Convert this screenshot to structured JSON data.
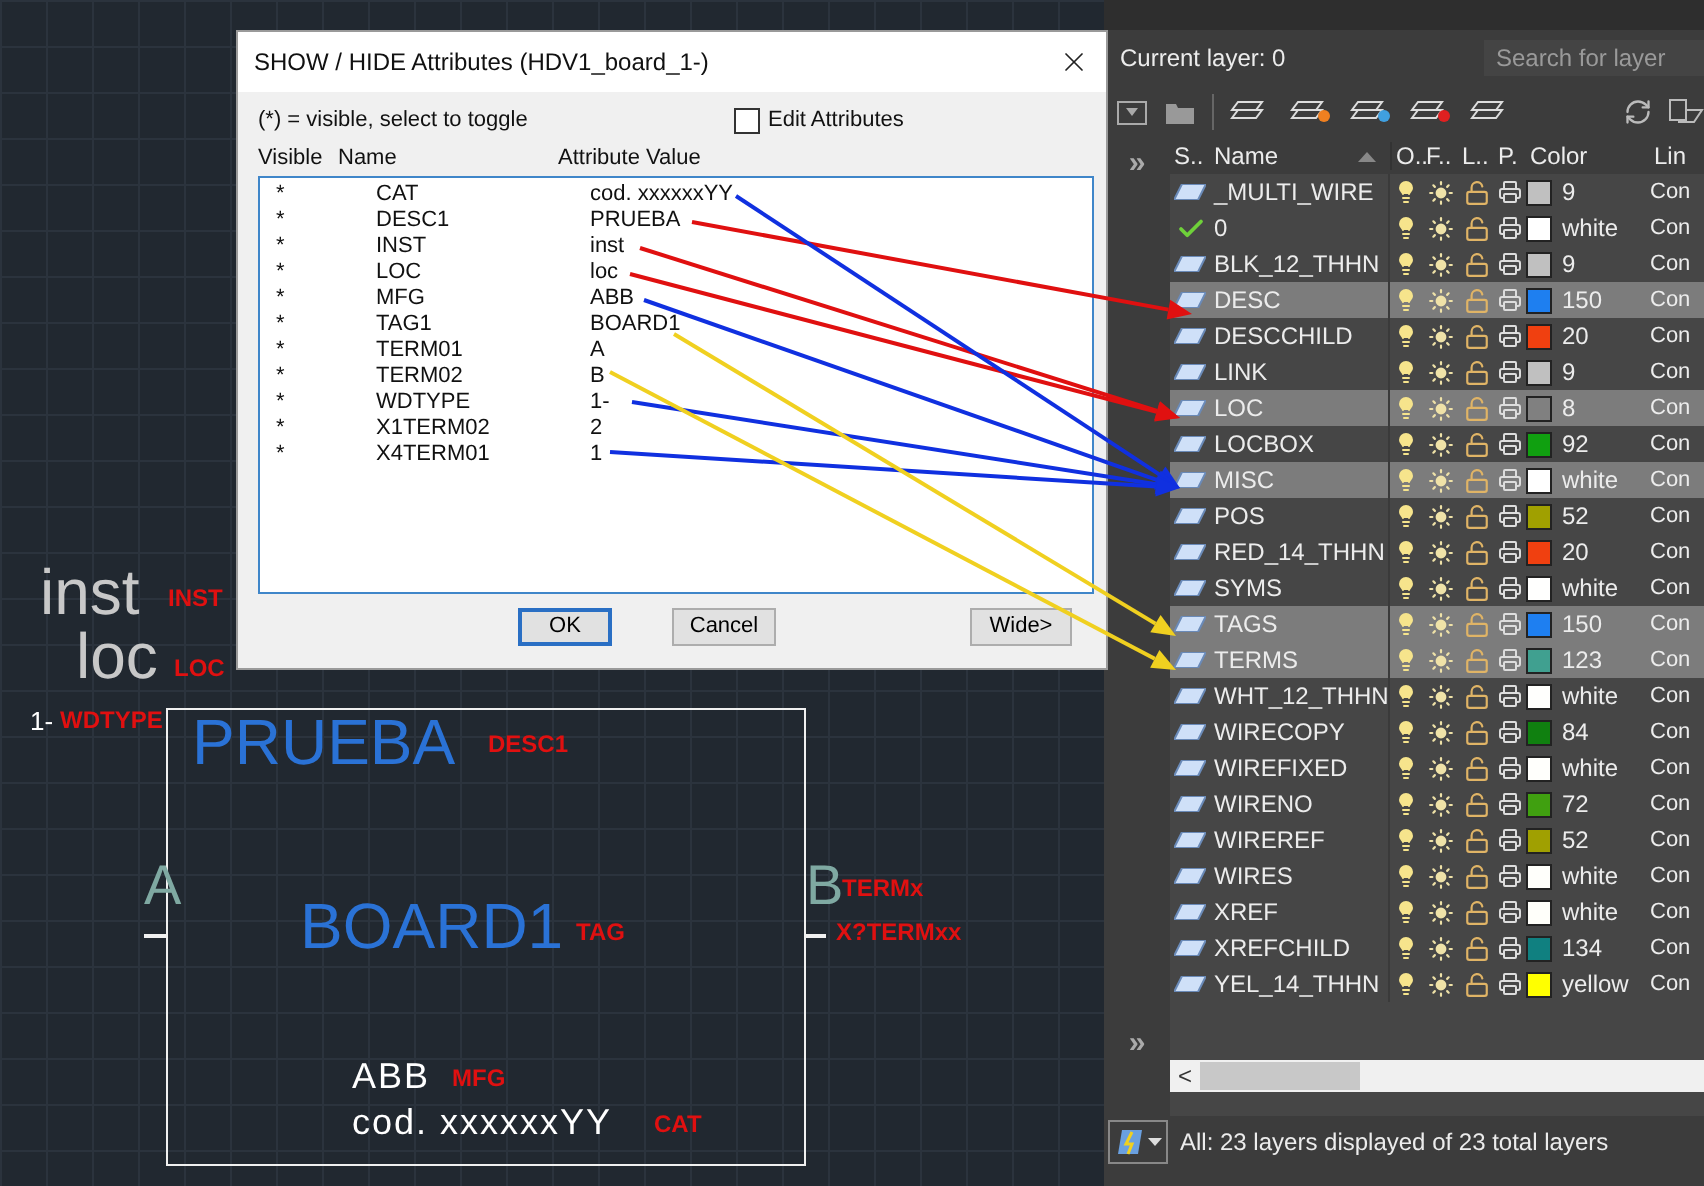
{
  "drawing": {
    "texts": [
      {
        "text": "inst",
        "kind": "value",
        "color": "#c8c8c8"
      },
      {
        "text": "INST",
        "kind": "tag",
        "color": "#e01010"
      },
      {
        "text": "loc",
        "kind": "value",
        "color": "#c8c8c8"
      },
      {
        "text": "LOC",
        "kind": "tag",
        "color": "#e01010"
      },
      {
        "text": "1-",
        "kind": "small",
        "color": "#ffffff"
      },
      {
        "text": "WDTYPE",
        "kind": "tag",
        "color": "#e01010"
      },
      {
        "text": "PRUEBA",
        "kind": "value",
        "color": "#2a72d6"
      },
      {
        "text": "DESC1",
        "kind": "tag",
        "color": "#e01010"
      },
      {
        "text": "A",
        "kind": "pin",
        "color": "#7fa9a2"
      },
      {
        "text": "B",
        "kind": "pin",
        "color": "#7fa9a2"
      },
      {
        "text": "TERMx",
        "kind": "tag",
        "color": "#e01010"
      },
      {
        "text": "X?TERMxx",
        "kind": "tag",
        "color": "#e01010"
      },
      {
        "text": "BOARD1",
        "kind": "value",
        "color": "#2a72d6"
      },
      {
        "text": "TAG",
        "kind": "tag",
        "color": "#e01010"
      },
      {
        "text": "ABB",
        "kind": "mid",
        "color": "#ffffff"
      },
      {
        "text": "MFG",
        "kind": "tag",
        "color": "#e01010"
      },
      {
        "text": "cod. xxxxxxYY",
        "kind": "mid",
        "color": "#ffffff"
      },
      {
        "text": "CAT",
        "kind": "tag",
        "color": "#e01010"
      }
    ]
  },
  "dialog": {
    "title": "SHOW / HIDE Attributes (HDV1_board_1-)",
    "hint": "(*) = visible, select to toggle",
    "edit_attributes": {
      "label": "Edit Attributes",
      "checked": false
    },
    "columns": [
      "Visible",
      "Name",
      "Attribute Value"
    ],
    "attributes": [
      {
        "visible": "*",
        "name": "CAT",
        "value": "cod. xxxxxxYY"
      },
      {
        "visible": "*",
        "name": "DESC1",
        "value": "PRUEBA"
      },
      {
        "visible": "*",
        "name": "INST",
        "value": "inst"
      },
      {
        "visible": "*",
        "name": "LOC",
        "value": "loc"
      },
      {
        "visible": "*",
        "name": "MFG",
        "value": "ABB"
      },
      {
        "visible": "*",
        "name": "TAG1",
        "value": "BOARD1"
      },
      {
        "visible": "*",
        "name": "TERM01",
        "value": "A"
      },
      {
        "visible": "*",
        "name": "TERM02",
        "value": "B"
      },
      {
        "visible": "*",
        "name": "WDTYPE",
        "value": "1-"
      },
      {
        "visible": "*",
        "name": "X1TERM02",
        "value": "2"
      },
      {
        "visible": "*",
        "name": "X4TERM01",
        "value": "1"
      }
    ],
    "buttons": [
      {
        "label": "OK",
        "kind": "default"
      },
      {
        "label": "Cancel",
        "kind": "normal"
      },
      {
        "label": "Wide>",
        "kind": "normal"
      }
    ]
  },
  "annotation_arrows": [
    {
      "color": "#e01010"
    },
    {
      "color": "#e01010"
    },
    {
      "color": "#e01010"
    },
    {
      "color": "#1030e0"
    },
    {
      "color": "#1030e0"
    },
    {
      "color": "#1030e0"
    },
    {
      "color": "#1030e0"
    },
    {
      "color": "#f0d020"
    },
    {
      "color": "#f0d020"
    }
  ],
  "layer_panel": {
    "current_layer": "Current layer: 0",
    "search": {
      "placeholder": "Search for layer"
    },
    "columns": [
      "S..",
      "Name",
      "O..",
      "F..",
      "L..",
      "P.",
      "Color",
      "Lin"
    ],
    "layers": [
      {
        "name": "_MULTI_WIRE",
        "kind": "layer",
        "selected": false,
        "color": "#c0c0c0",
        "color_name": "9",
        "linetype": "Con"
      },
      {
        "name": "0",
        "kind": "current",
        "selected": false,
        "color": "#ffffff",
        "color_name": "white",
        "linetype": "Con"
      },
      {
        "name": "BLK_12_THHN",
        "kind": "layer",
        "selected": false,
        "color": "#c0c0c0",
        "color_name": "9",
        "linetype": "Con"
      },
      {
        "name": "DESC",
        "kind": "layer",
        "selected": true,
        "color": "#1e7ff0",
        "color_name": "150",
        "linetype": "Con"
      },
      {
        "name": "DESCCHILD",
        "kind": "layer",
        "selected": false,
        "color": "#f04010",
        "color_name": "20",
        "linetype": "Con"
      },
      {
        "name": "LINK",
        "kind": "layer",
        "selected": false,
        "color": "#c0c0c0",
        "color_name": "9",
        "linetype": "Con"
      },
      {
        "name": "LOC",
        "kind": "layer",
        "selected": true,
        "color": "#808080",
        "color_name": "8",
        "linetype": "Con"
      },
      {
        "name": "LOCBOX",
        "kind": "layer",
        "selected": false,
        "color": "#10a010",
        "color_name": "92",
        "linetype": "Con"
      },
      {
        "name": "MISC",
        "kind": "layer",
        "selected": true,
        "color": "#ffffff",
        "color_name": "white",
        "linetype": "Con"
      },
      {
        "name": "POS",
        "kind": "layer",
        "selected": false,
        "color": "#a0a000",
        "color_name": "52",
        "linetype": "Con"
      },
      {
        "name": "RED_14_THHN",
        "kind": "layer",
        "selected": false,
        "color": "#f04010",
        "color_name": "20",
        "linetype": "Con"
      },
      {
        "name": "SYMS",
        "kind": "layer",
        "selected": false,
        "color": "#fffffe",
        "color_name": "white",
        "linetype": "Con"
      },
      {
        "name": "TAGS",
        "kind": "layer",
        "selected": true,
        "color": "#1e7ff1",
        "color_name": "150",
        "linetype": "Con"
      },
      {
        "name": "TERMS",
        "kind": "layer",
        "selected": true,
        "color": "#40a090",
        "color_name": "123",
        "linetype": "Con"
      },
      {
        "name": "WHT_12_THHN",
        "kind": "layer",
        "selected": false,
        "color": "#fffffd",
        "color_name": "white",
        "linetype": "Con"
      },
      {
        "name": "WIRECOPY",
        "kind": "layer",
        "selected": false,
        "color": "#108010",
        "color_name": "84",
        "linetype": "Con"
      },
      {
        "name": "WIREFIXED",
        "kind": "layer",
        "selected": false,
        "color": "#fffffc",
        "color_name": "white",
        "linetype": "Con"
      },
      {
        "name": "WIRENO",
        "kind": "layer",
        "selected": false,
        "color": "#40a010",
        "color_name": "72",
        "linetype": "Con"
      },
      {
        "name": "WIREREF",
        "kind": "layer",
        "selected": false,
        "color": "#a0a001",
        "color_name": "52",
        "linetype": "Con"
      },
      {
        "name": "WIRES",
        "kind": "layer",
        "selected": false,
        "color": "#fffffb",
        "color_name": "white",
        "linetype": "Con"
      },
      {
        "name": "XREF",
        "kind": "layer",
        "selected": false,
        "color": "#fffffa",
        "color_name": "white",
        "linetype": "Con"
      },
      {
        "name": "XREFCHILD",
        "kind": "layer",
        "selected": false,
        "color": "#108080",
        "color_name": "134",
        "linetype": "Con"
      },
      {
        "name": "YEL_14_THHN",
        "kind": "layer",
        "selected": false,
        "color": "#ffff00",
        "color_name": "yellow",
        "linetype": "Con"
      }
    ],
    "expand_glyph": "»",
    "collapse_glyph": "»",
    "scroll_left": "<",
    "status": "All: 23 layers displayed of 23 total layers"
  }
}
